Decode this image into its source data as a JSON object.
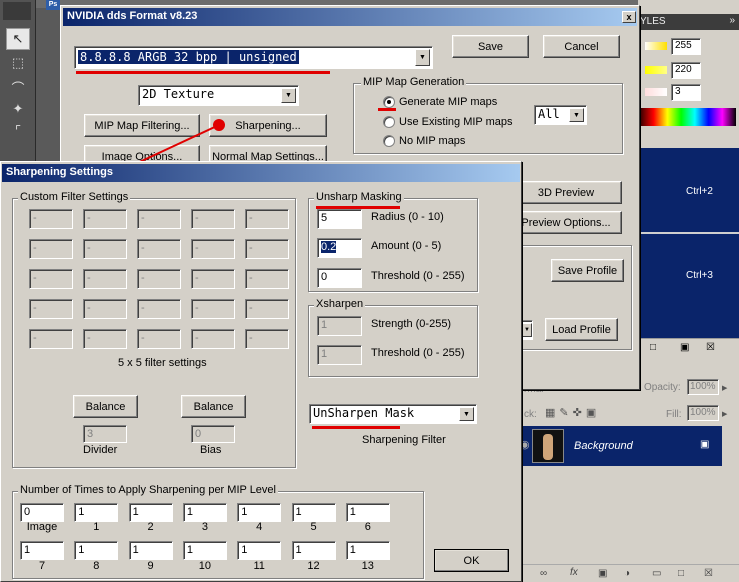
{
  "photoshop": {
    "styles_tab": "YLES",
    "color_values": [
      "255",
      "220",
      "3"
    ],
    "shortcut_1": "Ctrl+2",
    "shortcut_2": "Ctrl+3",
    "opacity_label": "Opacity:",
    "opacity_value": "100%",
    "fill_label": "Fill:",
    "fill_value": "100%",
    "lock_label": "ck:",
    "normal_label": "rmal",
    "layer_name": "Background"
  },
  "dds_dialog": {
    "title": "NVIDIA dds Format v8.23",
    "close_label": "x",
    "format": "8.8.8.8      ARGB  32 bpp | unsigned",
    "texture_type": "2D Texture",
    "save_label": "Save",
    "cancel_label": "Cancel",
    "mip_filtering_label": "MIP Map Filtering...",
    "sharpening_label": "Sharpening...",
    "image_options_label": "Image Options...",
    "normal_map_settings_label": "Normal Map Settings...",
    "mip_group_label": "MIP Map Generation",
    "mip_options": [
      "Generate MIP maps",
      "Use Existing MIP maps",
      "No MIP maps"
    ],
    "mip_count": "All",
    "preview_3d_label": "3D Preview",
    "preview_options_label": "Preview Options...",
    "save_profile_label": "Save Profile",
    "load_profile_label": "Load Profile"
  },
  "sharpening_dialog": {
    "title": "Sharpening Settings",
    "custom_filter_label": "Custom Filter Settings",
    "filter_cell_value": "-",
    "filter_caption": "5 x 5 filter settings",
    "balance_label": "Balance",
    "divider_value": "3",
    "divider_label": "Divider",
    "bias_value": "0",
    "bias_label": "Bias",
    "unsharp_label": "Unsharp Masking",
    "radius_value": "5",
    "radius_label": "Radius (0 - 10)",
    "amount_value": "0.2",
    "amount_label": "Amount (0 - 5)",
    "threshold_value": "0",
    "threshold_label": "Threshold (0 - 255)",
    "xsharpen_label": "Xsharpen",
    "strength_value": "1",
    "strength_label": "Strength (0-255)",
    "xthreshold_value": "1",
    "xthreshold_label": "Threshold (0 - 255)",
    "filter_type": "UnSharpen Mask",
    "filter_type_label": "Sharpening Filter",
    "mip_level_group_label": "Number of Times to Apply Sharpening per MIP Level",
    "mip_levels": [
      {
        "label": "Image",
        "value": "0"
      },
      {
        "label": "1",
        "value": "1"
      },
      {
        "label": "2",
        "value": "1"
      },
      {
        "label": "3",
        "value": "1"
      },
      {
        "label": "4",
        "value": "1"
      },
      {
        "label": "5",
        "value": "1"
      },
      {
        "label": "6",
        "value": "1"
      },
      {
        "label": "7",
        "value": "1"
      },
      {
        "label": "8",
        "value": "1"
      },
      {
        "label": "9",
        "value": "1"
      },
      {
        "label": "10",
        "value": "1"
      },
      {
        "label": "11",
        "value": "1"
      },
      {
        "label": "12",
        "value": "1"
      },
      {
        "label": "13",
        "value": "1"
      }
    ],
    "ok_label": "OK"
  }
}
